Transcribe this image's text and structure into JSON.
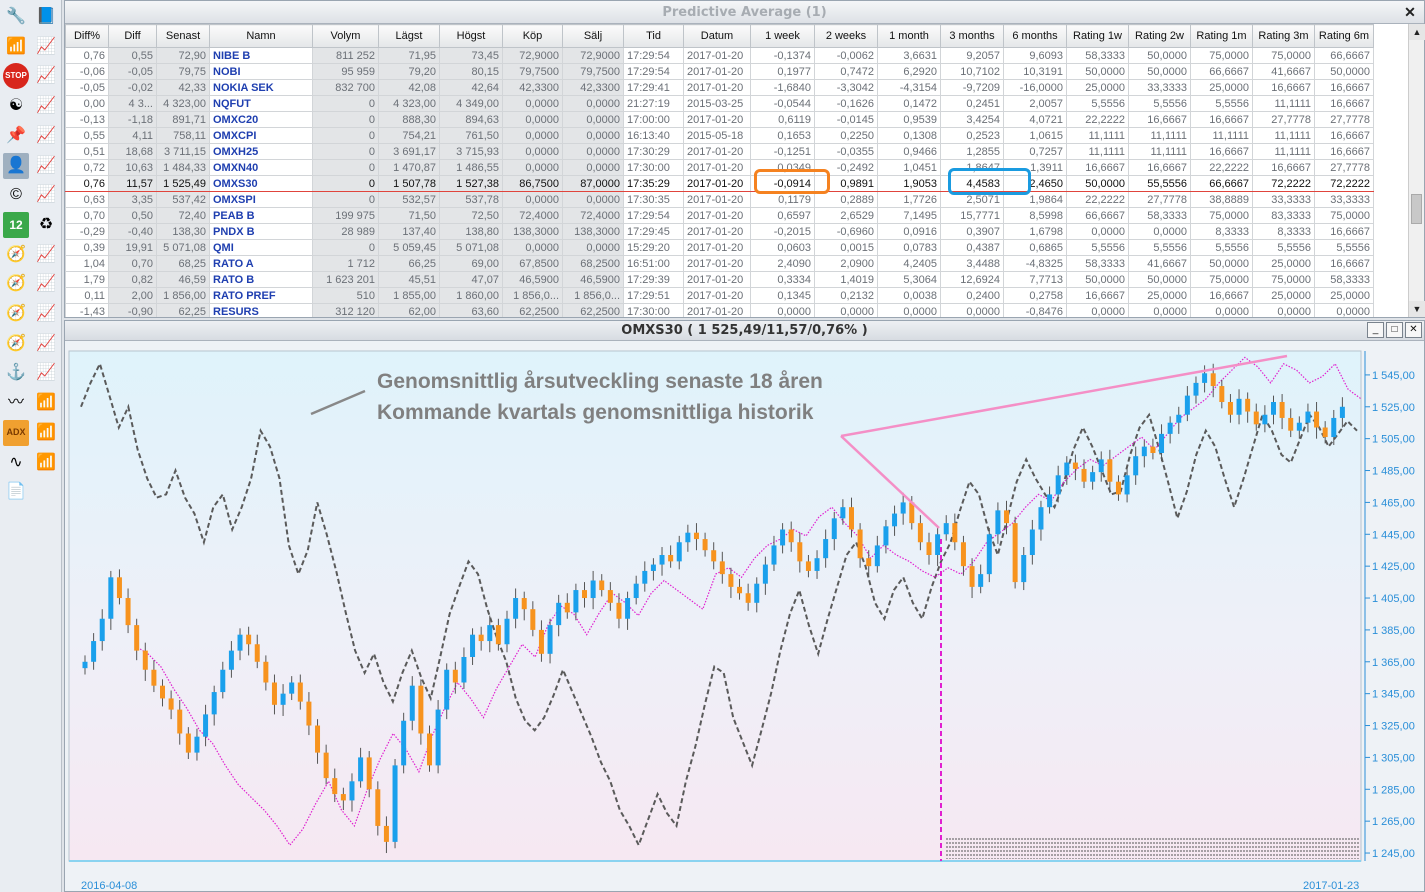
{
  "toolbar": {
    "icons": [
      "wrench-icon",
      "notes-icon",
      "bar-chart-icon",
      "line-chart-icon",
      "stop-icon",
      "line-chart-icon",
      "yin-yang-icon",
      "line-chart-icon",
      "pin-icon",
      "line-chart-icon",
      "avatar",
      "line-chart-icon",
      "c-logo-icon",
      "line-chart-icon",
      "calendar-icon",
      "cycle-icon",
      "compass-icon",
      "line-chart-icon",
      "compass-icon",
      "line-chart-icon",
      "compass-icon",
      "line-chart-icon",
      "compass-icon",
      "line-chart-icon",
      "anchor-icon",
      "line-chart-icon",
      "trend-icon",
      "bar-chart-icon",
      "adx-icon",
      "bar-chart-icon",
      "wave-icon",
      "bar-chart-icon",
      "document-icon"
    ],
    "stop_label": "STOP",
    "calendar_label": "12",
    "adx_label": "ADX"
  },
  "grid_window": {
    "title": "Predictive Average (1)",
    "close_label": "✕",
    "columns": [
      "Diff%",
      "Diff",
      "Senast",
      "Namn",
      "Volym",
      "Lägst",
      "Högst",
      "Köp",
      "Sälj",
      "Tid",
      "Datum",
      "1 week",
      "2 weeks",
      "1 month",
      "3 months",
      "6 months",
      "Rating 1w",
      "Rating 2w",
      "Rating 1m",
      "Rating 3m",
      "Rating 6m"
    ],
    "rows": [
      [
        "0,76",
        "0,55",
        "72,90",
        "NIBE B",
        "811 252",
        "71,95",
        "73,45",
        "72,9000",
        "72,9000",
        "17:29:54",
        "2017-01-20",
        "-0,1374",
        "-0,0062",
        "3,6631",
        "9,2057",
        "9,6093",
        "58,3333",
        "50,0000",
        "75,0000",
        "75,0000",
        "66,6667"
      ],
      [
        "-0,06",
        "-0,05",
        "79,75",
        "NOBI",
        "95 959",
        "79,20",
        "80,15",
        "79,7500",
        "79,7500",
        "17:29:54",
        "2017-01-20",
        "0,1977",
        "0,7472",
        "6,2920",
        "10,7102",
        "10,3191",
        "50,0000",
        "50,0000",
        "66,6667",
        "41,6667",
        "50,0000"
      ],
      [
        "-0,05",
        "-0,02",
        "42,33",
        "NOKIA SEK",
        "832 700",
        "42,08",
        "42,64",
        "42,3300",
        "42,3300",
        "17:29:41",
        "2017-01-20",
        "-1,6840",
        "-3,3042",
        "-4,3154",
        "-9,7209",
        "-16,0000",
        "25,0000",
        "33,3333",
        "25,0000",
        "16,6667",
        "16,6667"
      ],
      [
        "0,00",
        "4 3...",
        "4 323,00",
        "NQFUT",
        "0",
        "4 323,00",
        "4 349,00",
        "0,0000",
        "0,0000",
        "21:27:19",
        "2015-03-25",
        "-0,0544",
        "-0,1626",
        "0,1472",
        "0,2451",
        "2,0057",
        "5,5556",
        "5,5556",
        "5,5556",
        "11,1111",
        "16,6667"
      ],
      [
        "-0,13",
        "-1,18",
        "891,71",
        "OMXC20",
        "0",
        "888,30",
        "894,63",
        "0,0000",
        "0,0000",
        "17:00:00",
        "2017-01-20",
        "0,6119",
        "-0,0145",
        "0,9539",
        "3,4254",
        "4,0721",
        "22,2222",
        "16,6667",
        "16,6667",
        "27,7778",
        "27,7778"
      ],
      [
        "0,55",
        "4,11",
        "758,11",
        "OMXCPI",
        "0",
        "754,21",
        "761,50",
        "0,0000",
        "0,0000",
        "16:13:40",
        "2015-05-18",
        "0,1653",
        "0,2250",
        "0,1308",
        "0,2523",
        "1,0615",
        "11,1111",
        "11,1111",
        "11,1111",
        "11,1111",
        "16,6667"
      ],
      [
        "0,51",
        "18,68",
        "3 711,15",
        "OMXH25",
        "0",
        "3 691,17",
        "3 715,93",
        "0,0000",
        "0,0000",
        "17:30:29",
        "2017-01-20",
        "-0,1251",
        "-0,0355",
        "0,9466",
        "1,2855",
        "0,7257",
        "11,1111",
        "11,1111",
        "16,6667",
        "11,1111",
        "16,6667"
      ],
      [
        "0,72",
        "10,63",
        "1 484,33",
        "OMXN40",
        "0",
        "1 470,87",
        "1 486,55",
        "0,0000",
        "0,0000",
        "17:30:00",
        "2017-01-20",
        "0,0349",
        "-0,2492",
        "1,0451",
        "1,8647",
        "1,3911",
        "16,6667",
        "16,6667",
        "22,2222",
        "16,6667",
        "27,7778"
      ],
      [
        "0,76",
        "11,57",
        "1 525,49",
        "OMXS30",
        "0",
        "1 507,78",
        "1 527,38",
        "86,7500",
        "87,0000",
        "17:35:29",
        "2017-01-20",
        "-0,0914",
        "0,9891",
        "1,9053",
        "4,4583",
        "2,4650",
        "50,0000",
        "55,5556",
        "66,6667",
        "72,2222",
        "72,2222"
      ],
      [
        "0,63",
        "3,35",
        "537,42",
        "OMXSPI",
        "0",
        "532,57",
        "537,78",
        "0,0000",
        "0,0000",
        "17:30:35",
        "2017-01-20",
        "0,1179",
        "0,2889",
        "1,7726",
        "2,5071",
        "1,9864",
        "22,2222",
        "27,7778",
        "38,8889",
        "33,3333",
        "33,3333"
      ],
      [
        "0,70",
        "0,50",
        "72,40",
        "PEAB B",
        "199 975",
        "71,50",
        "72,50",
        "72,4000",
        "72,4000",
        "17:29:54",
        "2017-01-20",
        "0,6597",
        "2,6529",
        "7,1495",
        "15,7771",
        "8,5998",
        "66,6667",
        "58,3333",
        "75,0000",
        "83,3333",
        "75,0000"
      ],
      [
        "-0,29",
        "-0,40",
        "138,30",
        "PNDX B",
        "28 989",
        "137,40",
        "138,80",
        "138,3000",
        "138,3000",
        "17:29:45",
        "2017-01-20",
        "-0,2015",
        "-0,6960",
        "0,0916",
        "0,3907",
        "1,6798",
        "0,0000",
        "0,0000",
        "8,3333",
        "8,3333",
        "16,6667"
      ],
      [
        "0,39",
        "19,91",
        "5 071,08",
        "QMI",
        "0",
        "5 059,45",
        "5 071,08",
        "0,0000",
        "0,0000",
        "15:29:20",
        "2017-01-20",
        "0,0603",
        "0,0015",
        "0,0783",
        "0,4387",
        "0,6865",
        "5,5556",
        "5,5556",
        "5,5556",
        "5,5556",
        "5,5556"
      ],
      [
        "1,04",
        "0,70",
        "68,25",
        "RATO A",
        "1 712",
        "66,25",
        "69,00",
        "67,8500",
        "68,2500",
        "16:51:00",
        "2017-01-20",
        "2,4090",
        "2,0900",
        "4,2405",
        "3,4488",
        "-4,8325",
        "58,3333",
        "41,6667",
        "50,0000",
        "25,0000",
        "16,6667"
      ],
      [
        "1,79",
        "0,82",
        "46,59",
        "RATO B",
        "1 623 201",
        "45,51",
        "47,07",
        "46,5900",
        "46,5900",
        "17:29:39",
        "2017-01-20",
        "0,3334",
        "1,4019",
        "5,3064",
        "12,6924",
        "7,7713",
        "50,0000",
        "50,0000",
        "75,0000",
        "75,0000",
        "58,3333"
      ],
      [
        "0,11",
        "2,00",
        "1 856,00",
        "RATO PREF",
        "510",
        "1 855,00",
        "1 860,00",
        "1 856,0...",
        "1 856,0...",
        "17:29:51",
        "2017-01-20",
        "0,1345",
        "0,2132",
        "0,0038",
        "0,2400",
        "0,2758",
        "16,6667",
        "25,0000",
        "16,6667",
        "25,0000",
        "25,0000"
      ],
      [
        "-1,43",
        "-0,90",
        "62,25",
        "RESURS",
        "312 120",
        "62,00",
        "63,60",
        "62,2500",
        "62,2500",
        "17:30:00",
        "2017-01-20",
        "0,0000",
        "0,0000",
        "0,0000",
        "0,0000",
        "-0,8476",
        "0,0000",
        "0,0000",
        "0,0000",
        "0,0000",
        "0,0000"
      ]
    ],
    "selected_row": 8
  },
  "chart_window": {
    "title": "OMXS30 ( 1 525,49/11,57/0,76% )",
    "buttons": [
      "_",
      "□",
      "✕"
    ],
    "annotation_line1": "Genomsnittlig årsutveckling senaste 18 åren",
    "annotation_line2": "Kommande kvartals genomsnittliga historik",
    "colors": {
      "up": "#1aa0ec",
      "down": "#f7931e",
      "forecast": "#e020d0",
      "history": "#5a5a5a",
      "trend": "#f48fc6"
    }
  },
  "chart_data": {
    "type": "candlestick",
    "x_start_label": "2016-04-08",
    "x_end_label": "2017-01-23",
    "y_ticks": [
      "1 545,00",
      "1 525,00",
      "1 505,00",
      "1 485,00",
      "1 465,00",
      "1 445,00",
      "1 425,00",
      "1 405,00",
      "1 385,00",
      "1 365,00",
      "1 345,00",
      "1 325,00",
      "1 305,00",
      "1 285,00",
      "1 265,00",
      "1 245,00"
    ],
    "ylim": [
      1240,
      1560
    ],
    "closes": [
      1365,
      1378,
      1392,
      1418,
      1405,
      1388,
      1372,
      1360,
      1350,
      1342,
      1335,
      1320,
      1308,
      1318,
      1332,
      1346,
      1360,
      1372,
      1382,
      1376,
      1365,
      1352,
      1338,
      1345,
      1352,
      1340,
      1325,
      1308,
      1292,
      1282,
      1278,
      1290,
      1305,
      1285,
      1262,
      1252,
      1300,
      1328,
      1350,
      1320,
      1300,
      1335,
      1360,
      1352,
      1368,
      1382,
      1378,
      1388,
      1376,
      1392,
      1405,
      1398,
      1385,
      1370,
      1388,
      1402,
      1396,
      1410,
      1405,
      1416,
      1410,
      1402,
      1392,
      1405,
      1414,
      1422,
      1426,
      1432,
      1428,
      1440,
      1446,
      1442,
      1435,
      1428,
      1420,
      1412,
      1408,
      1402,
      1414,
      1426,
      1438,
      1448,
      1440,
      1428,
      1422,
      1430,
      1442,
      1455,
      1462,
      1448,
      1430,
      1425,
      1438,
      1450,
      1458,
      1465,
      1452,
      1440,
      1432,
      1445,
      1452,
      1440,
      1425,
      1412,
      1420,
      1445,
      1460,
      1452,
      1415,
      1432,
      1448,
      1462,
      1470,
      1482,
      1490,
      1486,
      1478,
      1484,
      1492,
      1478,
      1470,
      1482,
      1494,
      1500,
      1496,
      1508,
      1515,
      1520,
      1532,
      1540,
      1546,
      1538,
      1528,
      1520,
      1530,
      1522,
      1514,
      1520,
      1528,
      1518,
      1510,
      1515,
      1522,
      1512,
      1506,
      1518,
      1525
    ],
    "history_line": [
      1525,
      1540,
      1552,
      1532,
      1512,
      1525,
      1498,
      1480,
      1468,
      1470,
      1485,
      1468,
      1458,
      1440,
      1462,
      1470,
      1448,
      1462,
      1480,
      1510,
      1500,
      1480,
      1438,
      1420,
      1435,
      1465,
      1445,
      1422,
      1396,
      1372,
      1358,
      1370,
      1352,
      1340,
      1358,
      1372,
      1355,
      1342,
      1368,
      1395,
      1412,
      1428,
      1420,
      1398,
      1380,
      1365,
      1342,
      1328,
      1322,
      1330,
      1344,
      1360,
      1346,
      1332,
      1318,
      1302,
      1290,
      1272,
      1262,
      1250,
      1266,
      1282,
      1270,
      1262,
      1290,
      1312,
      1338,
      1362,
      1358,
      1330,
      1315,
      1300,
      1322,
      1345,
      1372,
      1395,
      1410,
      1388,
      1370,
      1392,
      1412,
      1432,
      1440,
      1425,
      1402,
      1392,
      1410,
      1418,
      1402,
      1392,
      1412,
      1428,
      1440,
      1460,
      1478,
      1470,
      1448,
      1432,
      1455,
      1478,
      1492,
      1480,
      1470,
      1462,
      1478,
      1498,
      1512,
      1500,
      1485,
      1470,
      1472,
      1495,
      1512,
      1520,
      1500,
      1478,
      1455,
      1472,
      1495,
      1510,
      1500,
      1480,
      1462,
      1480,
      1500,
      1520,
      1510,
      1495,
      1490,
      1505,
      1520,
      1512,
      1500,
      1508,
      1516,
      1510
    ],
    "forecast_line": [
      1375,
      1370,
      1362,
      1348,
      1336,
      1322,
      1314,
      1300,
      1288,
      1280,
      1272,
      1262,
      1250,
      1260,
      1276,
      1290,
      1272,
      1262,
      1285,
      1304,
      1320,
      1310,
      1296,
      1318,
      1336,
      1352,
      1342,
      1330,
      1348,
      1362,
      1376,
      1368,
      1388,
      1400,
      1395,
      1382,
      1396,
      1408,
      1402,
      1394,
      1408,
      1416,
      1410,
      1404,
      1398,
      1420,
      1424,
      1418,
      1430,
      1438,
      1442,
      1448,
      1444,
      1456,
      1462,
      1452,
      1444,
      1430,
      1438,
      1432,
      1428,
      1422,
      1418,
      1424,
      1420,
      1428,
      1440,
      1446,
      1452,
      1462,
      1470,
      1466,
      1478,
      1486,
      1492,
      1488,
      1494,
      1500,
      1506,
      1498,
      1508,
      1518,
      1524,
      1530,
      1540,
      1548,
      1556,
      1550,
      1540,
      1552,
      1548,
      1540,
      1544,
      1552,
      1536,
      1530
    ],
    "trend_line": [
      [
        1470,
        1505
      ],
      [
        1525,
        1548
      ]
    ]
  }
}
